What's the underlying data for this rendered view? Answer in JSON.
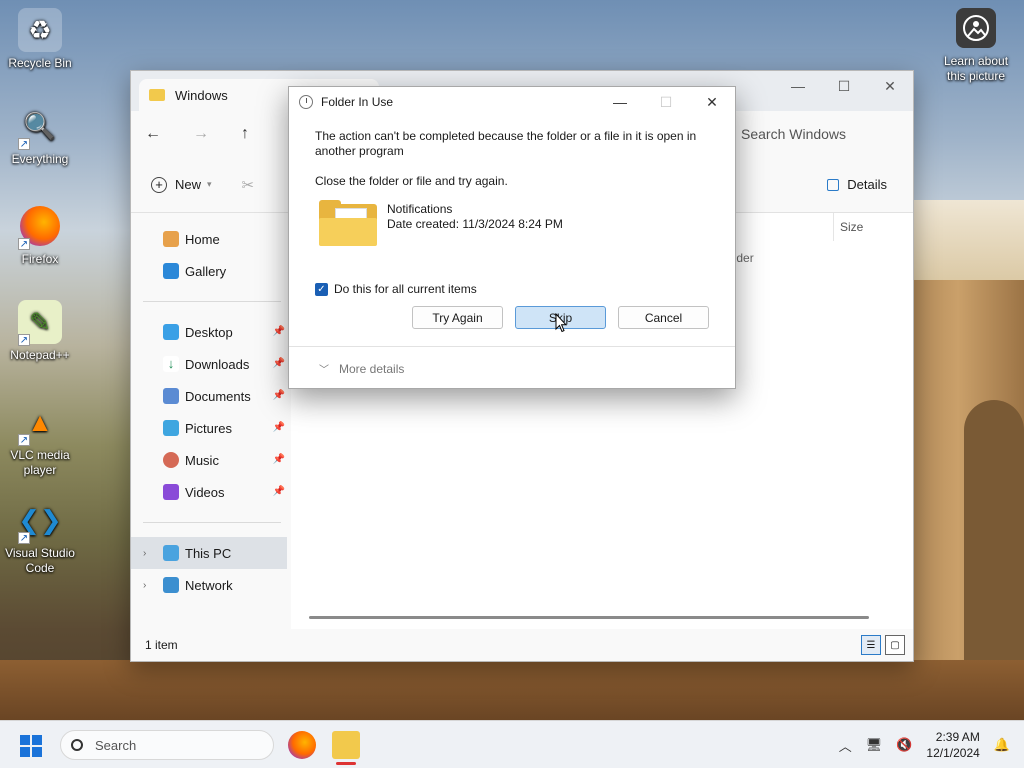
{
  "desktop": {
    "icons": [
      {
        "label": "Recycle Bin"
      },
      {
        "label": "Everything"
      },
      {
        "label": "Firefox"
      },
      {
        "label": "Notepad++"
      },
      {
        "label": "VLC media player"
      },
      {
        "label": "Visual Studio Code"
      }
    ],
    "learn_label": "Learn about this picture"
  },
  "explorer": {
    "tab_title": "Windows",
    "search_placeholder": "Search Windows",
    "new_label": "New",
    "details_label": "Details",
    "nav_items": [
      {
        "label": "Home"
      },
      {
        "label": "Gallery"
      },
      {
        "label": "Desktop"
      },
      {
        "label": "Downloads"
      },
      {
        "label": "Documents"
      },
      {
        "label": "Pictures"
      },
      {
        "label": "Music"
      },
      {
        "label": "Videos"
      },
      {
        "label": "This PC"
      },
      {
        "label": "Network"
      }
    ],
    "column_size": "Size",
    "row_type_fragment": "older",
    "status": "1 item"
  },
  "dialog": {
    "title": "Folder In Use",
    "message": "The action can't be completed because the folder or a file in it is open in another program",
    "instruction": "Close the folder or file and try again.",
    "file_name": "Notifications",
    "file_date": "Date created: 11/3/2024 8:24 PM",
    "checkbox_label": "Do this for all current items",
    "checkbox_checked": true,
    "buttons": {
      "try_again": "Try Again",
      "skip": "Skip",
      "cancel": "Cancel"
    },
    "more_details": "More details"
  },
  "taskbar": {
    "search_placeholder": "Search",
    "time": "2:39 AM",
    "date": "12/1/2024"
  },
  "colors": {
    "accent": "#1a5fb4",
    "folder": "#f6cf5a",
    "default_button": "#cfe4f7"
  }
}
